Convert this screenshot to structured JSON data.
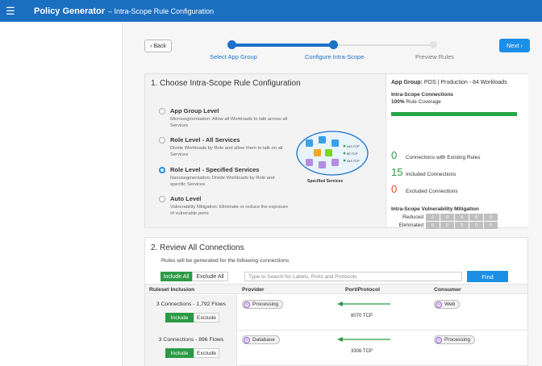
{
  "header": {
    "app_title": "Policy Generator",
    "subtitle": "– Intra-Scope Rule Configuration",
    "menu_icon": "hamburger-icon"
  },
  "wizard": {
    "back_label": "‹ Back",
    "next_label": "Next ›",
    "steps": [
      {
        "label": "Select App Group",
        "state": "done"
      },
      {
        "label": "Configure Intra-Scope",
        "state": "current"
      },
      {
        "label": "Preview Rules",
        "state": "pending"
      }
    ]
  },
  "config": {
    "title": "1. Choose Intra-Scope Rule Configuration",
    "options": [
      {
        "title": "App Group Level",
        "desc": "Microsegmentation: Allow all Workloads to talk across all Services",
        "selected": false
      },
      {
        "title": "Role Level - All Services",
        "desc": "Divide Workloads by Role and allow them to talk on all Services",
        "selected": false
      },
      {
        "title": "Role Level - Specified Services",
        "desc": "Nanosegmentation: Divide Workloads by Role and specific Services",
        "selected": true
      },
      {
        "title": "Auto Level",
        "desc": "Vulnerability Mitigation: Eliminate or reduce the exposure of vulnerable ports",
        "selected": false
      }
    ],
    "diagram_label": "Specified Services",
    "diagram_legend": [
      "443 TCP",
      "80 TCP",
      "443 TCP"
    ]
  },
  "summary": {
    "app_group_label": "App Group:",
    "app_group_value": "POS | Production - 84 Workloads",
    "connections_heading": "Intra-Scope Connections",
    "coverage_pct": "100%",
    "coverage_text": "Rule Coverage",
    "coverage_fraction": 1.0,
    "stats": [
      {
        "num": "0",
        "label": "Connections with Existing Rules",
        "color": "#2b9a45"
      },
      {
        "num": "15",
        "label": "Included Connections",
        "color": "#2b9a45"
      },
      {
        "num": "0",
        "label": "Excluded Connections",
        "color": "#e8462e"
      }
    ],
    "vuln_heading": "Intra-Scope Vulnerability Mitigation",
    "reduced_label": "Reduced",
    "eliminated_label": "Eliminated",
    "reduced_values": [
      "0",
      "0",
      "0",
      "0",
      "0"
    ],
    "eliminated_values": [
      "0",
      "0",
      "0",
      "0",
      "0"
    ]
  },
  "review": {
    "title": "2. Review All Connections",
    "subtitle": "Rules will be generated for the following connections",
    "include_all": "Include All",
    "exclude_all": "Exclude All",
    "search_placeholder": "Type to Search for Labels, Ports and Protocols",
    "find_label": "Find",
    "columns": [
      "Ruleset Inclusion",
      "Provider",
      "Port/Protocol",
      "Consumer"
    ],
    "rows": [
      {
        "summary": "3 Connections - 1,792 Flows",
        "include": "Include",
        "exclude": "Exclude",
        "provider": "Processing",
        "port": "8070 TCP",
        "consumer": "Web"
      },
      {
        "summary": "3 Connections - 896 Flows",
        "include": "Include",
        "exclude": "Exclude",
        "provider": "Database",
        "port": "3306 TCP",
        "consumer": "Processing"
      }
    ]
  },
  "colors": {
    "brand_blue": "#1b6fc0",
    "accent_blue": "#1b8fe6",
    "include_green": "#2b9a45",
    "excluded_red": "#e8462e"
  }
}
